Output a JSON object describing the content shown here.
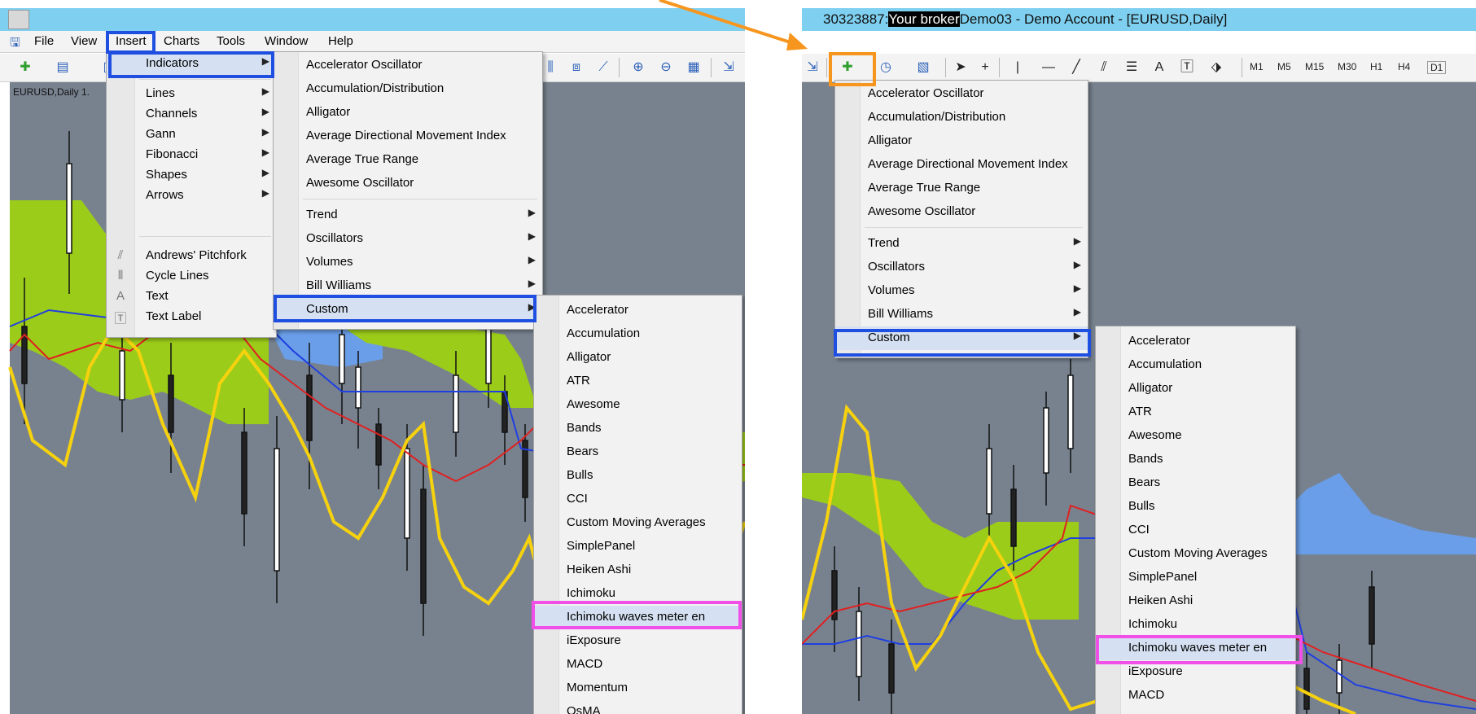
{
  "left": {
    "menubar": [
      "File",
      "View",
      "Insert",
      "Charts",
      "Tools",
      "Window",
      "Help"
    ],
    "chart_label": "EURUSD,Daily  1.",
    "insert_menu": {
      "indicators": "Indicators",
      "submenus": [
        "Lines",
        "Channels",
        "Gann",
        "Fibonacci",
        "Shapes",
        "Arrows"
      ],
      "tools": [
        {
          "label": "Andrews' Pitchfork",
          "icon": "⫽"
        },
        {
          "label": "Cycle Lines",
          "icon": "⦀"
        },
        {
          "label": "Text",
          "icon": "A"
        },
        {
          "label": "Text Label",
          "icon": "🅃"
        }
      ]
    },
    "indicators_menu": {
      "top": [
        "Accelerator Oscillator",
        "Accumulation/Distribution",
        "Alligator",
        "Average Directional Movement Index",
        "Average True Range",
        "Awesome Oscillator"
      ],
      "groups": [
        "Trend",
        "Oscillators",
        "Volumes",
        "Bill Williams",
        "Custom"
      ]
    },
    "custom_menu": [
      "Accelerator",
      "Accumulation",
      "Alligator",
      "ATR",
      "Awesome",
      "Bands",
      "Bears",
      "Bulls",
      "CCI",
      "Custom Moving Averages",
      "SimplePanel",
      "Heiken Ashi",
      "Ichimoku",
      "Ichimoku waves meter en",
      "iExposure",
      "MACD",
      "Momentum",
      "OsMA"
    ]
  },
  "right": {
    "title_prefix": "30323887:",
    "title_highlight": "Your broker",
    "title_suffix": "Demo03 - Demo Account - [EURUSD,Daily]",
    "timeframes": [
      "M1",
      "M5",
      "M15",
      "M30",
      "H1",
      "H4",
      "D1"
    ],
    "indicators_menu": {
      "top": [
        "Accelerator Oscillator",
        "Accumulation/Distribution",
        "Alligator",
        "Average Directional Movement Index",
        "Average True Range",
        "Awesome Oscillator"
      ],
      "groups": [
        "Trend",
        "Oscillators",
        "Volumes",
        "Bill Williams",
        "Custom"
      ]
    },
    "custom_menu": [
      "Accelerator",
      "Accumulation",
      "Alligator",
      "ATR",
      "Awesome",
      "Bands",
      "Bears",
      "Bulls",
      "CCI",
      "Custom Moving Averages",
      "SimplePanel",
      "Heiken Ashi",
      "Ichimoku",
      "Ichimoku waves meter en",
      "iExposure",
      "MACD"
    ]
  },
  "colors": {
    "highlight_blue": "#1f4fe0",
    "highlight_pink": "#f050e8",
    "highlight_orange": "#f7961e",
    "chart_bg": "#78828f"
  }
}
